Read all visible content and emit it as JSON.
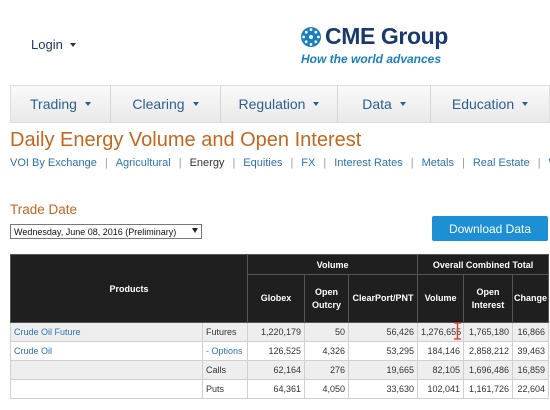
{
  "header": {
    "login_label": "Login",
    "logo_text": "CME Group",
    "logo_tagline": "How the world advances"
  },
  "nav": {
    "items": [
      {
        "label": "Trading"
      },
      {
        "label": "Clearing"
      },
      {
        "label": "Regulation"
      },
      {
        "label": "Data"
      },
      {
        "label": "Education"
      }
    ]
  },
  "page": {
    "title": "Daily Energy Volume and Open Interest",
    "subnav": [
      "VOI By Exchange",
      "Agricultural",
      "Energy",
      "Equities",
      "FX",
      "Interest Rates",
      "Metals",
      "Real Estate",
      "W"
    ],
    "subnav_current": "Energy",
    "trade_date_label": "Trade Date",
    "trade_date_value": "Wednesday, June 08, 2016 (Preliminary)",
    "download_label": "Download Data"
  },
  "table": {
    "group_headers": {
      "products": "Products",
      "volume": "Volume",
      "overall": "Overall Combined Total"
    },
    "columns": {
      "globex": "Globex",
      "open_outcry": [
        "Open",
        "Outcry"
      ],
      "clearport": "ClearPort/PNT",
      "volume": "Volume",
      "open_interest": [
        "Open",
        "Interest"
      ],
      "change": "Change"
    },
    "rows": [
      {
        "product": "Crude Oil Future",
        "type": "Futures",
        "globex": "1,220,179",
        "outcry": "50",
        "clearport": "56,426",
        "volume": "1,276,655",
        "oi": "1,765,180",
        "change": "16,866"
      },
      {
        "product": "Crude Oil",
        "type": "- Options",
        "globex": "126,525",
        "outcry": "4,326",
        "clearport": "53,295",
        "volume": "184,146",
        "oi": "2,858,212",
        "change": "39,463"
      },
      {
        "product": "",
        "type": "Calls",
        "globex": "62,164",
        "outcry": "276",
        "clearport": "19,665",
        "volume": "82,105",
        "oi": "1,696,486",
        "change": "16,859"
      },
      {
        "product": "",
        "type": "Puts",
        "globex": "64,361",
        "outcry": "4,050",
        "clearport": "33,630",
        "volume": "102,041",
        "oi": "1,161,726",
        "change": "22,604"
      }
    ]
  },
  "colors": {
    "brand_navy": "#1a3a6e",
    "brand_blue": "#1a7fc1",
    "title_orange": "#c4661f",
    "link_blue": "#2b72b5",
    "button_blue": "#1d8fd5",
    "header_black": "#1f1f1f"
  },
  "icons": [
    "cme-globe-logo-icon",
    "caret-down-icon",
    "select-arrow-icon",
    "mouse-cursor-icon"
  ]
}
